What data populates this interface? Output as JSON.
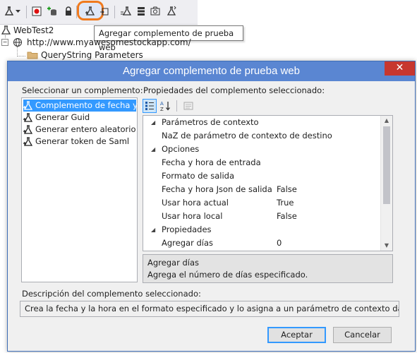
{
  "toolbar": {
    "icons": [
      "web-test-icon",
      "dropdown-icon",
      "stop-record-icon",
      "add-datasource-icon",
      "lock-icon",
      "add-plugin-icon",
      "extract-icon",
      "run-test-icon",
      "server-icon",
      "camera-icon",
      "flask-icon"
    ],
    "tooltip": "Agregar complemento de prueba web"
  },
  "tree": {
    "root": "WebTest2",
    "url": "http://www.myawesomestockapp.com/",
    "folder": "QueryString Parameters"
  },
  "dialog": {
    "title": "Agregar complemento de prueba web",
    "close_glyph": "✕",
    "select_label": "Seleccionar un complemento:",
    "plugins": [
      {
        "label": "Complemento de fecha y ..",
        "selected": true
      },
      {
        "label": "Generar Guid",
        "selected": false
      },
      {
        "label": "Generar entero aleatorio",
        "selected": false
      },
      {
        "label": "Generar token de Saml",
        "selected": false
      }
    ],
    "props_label": "Propiedades del complemento seleccionado:",
    "properties": [
      {
        "kind": "category",
        "name": "Parámetros de contexto",
        "value": ""
      },
      {
        "kind": "prop",
        "name": "NaZ de parámetro de contexto de destino",
        "value": ""
      },
      {
        "kind": "category",
        "name": "Opciones",
        "value": ""
      },
      {
        "kind": "prop",
        "name": "Fecha y hora de entrada",
        "value": ""
      },
      {
        "kind": "prop",
        "name": "Formato de salida",
        "value": ""
      },
      {
        "kind": "prop",
        "name": "Fecha y hora Json de salida",
        "value": "False"
      },
      {
        "kind": "prop",
        "name": "Usar hora actual",
        "value": "True"
      },
      {
        "kind": "prop",
        "name": "Usar hora local",
        "value": "False"
      },
      {
        "kind": "category",
        "name": "Propiedades",
        "value": ""
      },
      {
        "kind": "prop",
        "name": "Agregar días",
        "value": "0"
      }
    ],
    "help_title": "Agregar días",
    "help_text": "Agrega el número de días especificado.",
    "desc_label": "Descripción del complemento seleccionado:",
    "desc_text": "Crea la fecha y la hora en el formato especificado y lo asigna a un parámetro de contexto dado.",
    "ok_label": "Aceptar",
    "cancel_label": "Cancelar"
  },
  "colors": {
    "accent": "#5a86d2",
    "highlight": "#f07a1e",
    "selection": "#3399ff",
    "close": "#c7372f"
  }
}
